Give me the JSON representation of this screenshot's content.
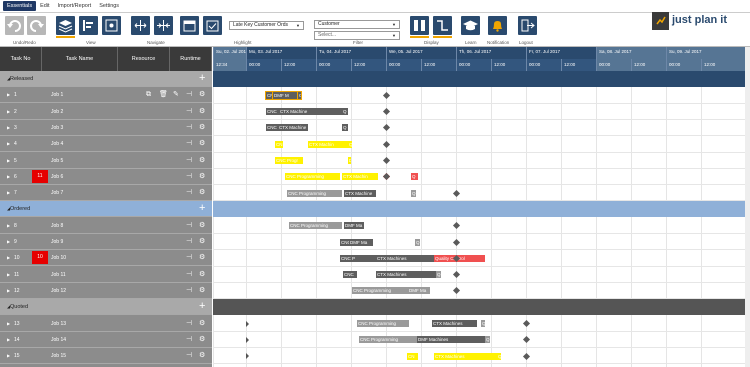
{
  "menu": {
    "items": [
      "Essentials",
      "Edit",
      "Import/Report",
      "Settings"
    ]
  },
  "ribbon": {
    "groups": {
      "undo": "Undo/Redo",
      "view": "View",
      "navigate": "Navigate",
      "highlight": "Highlight",
      "filter": "Filter",
      "display": "Display",
      "learn": "Learn",
      "notification": "Notification",
      "logout": "Logout"
    },
    "highlight_select": "Late Key Customer Ords",
    "filter_field": "Customer",
    "filter_value_placeholder": "Select..."
  },
  "logo": {
    "text": "just plan it"
  },
  "table": {
    "headers": {
      "task_no": "Task No",
      "task_name": "Task Name",
      "resource": "Resource",
      "runtime": "Runtime"
    }
  },
  "groups": [
    {
      "name": "Released"
    },
    {
      "name": "Ordered"
    },
    {
      "name": "Quoted"
    }
  ],
  "jobs": [
    {
      "no": "1",
      "name": "Job 1",
      "badge": ""
    },
    {
      "no": "2",
      "name": "Job 2",
      "badge": ""
    },
    {
      "no": "3",
      "name": "Job 3",
      "badge": ""
    },
    {
      "no": "4",
      "name": "Job 4",
      "badge": ""
    },
    {
      "no": "5",
      "name": "Job 5",
      "badge": ""
    },
    {
      "no": "6",
      "name": "Job 6",
      "badge": "11"
    },
    {
      "no": "7",
      "name": "Job 7",
      "badge": ""
    },
    {
      "no": "8",
      "name": "Job 8",
      "badge": ""
    },
    {
      "no": "9",
      "name": "Job 9",
      "badge": ""
    },
    {
      "no": "10",
      "name": "Job 10",
      "badge": "10"
    },
    {
      "no": "11",
      "name": "Job 11",
      "badge": ""
    },
    {
      "no": "12",
      "name": "Job 12",
      "badge": ""
    },
    {
      "no": "13",
      "name": "Job 13",
      "badge": ""
    },
    {
      "no": "14",
      "name": "Job 14",
      "badge": ""
    },
    {
      "no": "15",
      "name": "Job 15",
      "badge": ""
    }
  ],
  "timeline": {
    "days": [
      "Su, 02. Jul 201",
      "Mo, 03. Jul 2017",
      "Tu, 04. Jul 2017",
      "We, 05. Jul 2017",
      "Th, 06. Jul 2017",
      "Fr, 07. Jul 2017",
      "Sa, 08. Jul 2017",
      "Su, 09. Jul 2017"
    ],
    "times": [
      "12:34",
      "00:00",
      "12:00",
      "00:00",
      "12:00",
      "00:00",
      "12:00",
      "00:00",
      "12:00",
      "00:00",
      "12:00",
      "00:00",
      "12:00",
      "00:00",
      "12:00"
    ]
  },
  "bars": {
    "j1": [
      "CN",
      "DMF M",
      "C"
    ],
    "j2": [
      "CNC",
      "CTX Machine",
      "Q"
    ],
    "j3": [
      "CNC",
      "CTX Machine",
      "Q"
    ],
    "j4": [
      "CN",
      "CTX Machin",
      "Q"
    ],
    "j5": [
      "CNC Progr",
      "DMF"
    ],
    "j6": [
      "CNC Programming",
      "CTX Machin",
      "Q"
    ],
    "j7": [
      "CNC Programming",
      "CTX Machine",
      "Q"
    ],
    "j8": [
      "CNC Programming",
      "DMF Ma"
    ],
    "j9": [
      "CNC",
      "DMF Ma",
      "Q"
    ],
    "j10": [
      "CNC P",
      "CTX Machines",
      "Quality Control"
    ],
    "j11": [
      "CNC",
      "CTX Machines",
      "Q"
    ],
    "j12": [
      "CNC Programming",
      "DMF Ma"
    ],
    "j13": [
      "CNC Programming",
      "CTX Machines",
      "Q"
    ],
    "j14": [
      "CNC Programming",
      "DMF Machines",
      "Q"
    ],
    "j15": [
      "CN",
      "CTX Machines",
      "Q"
    ]
  }
}
